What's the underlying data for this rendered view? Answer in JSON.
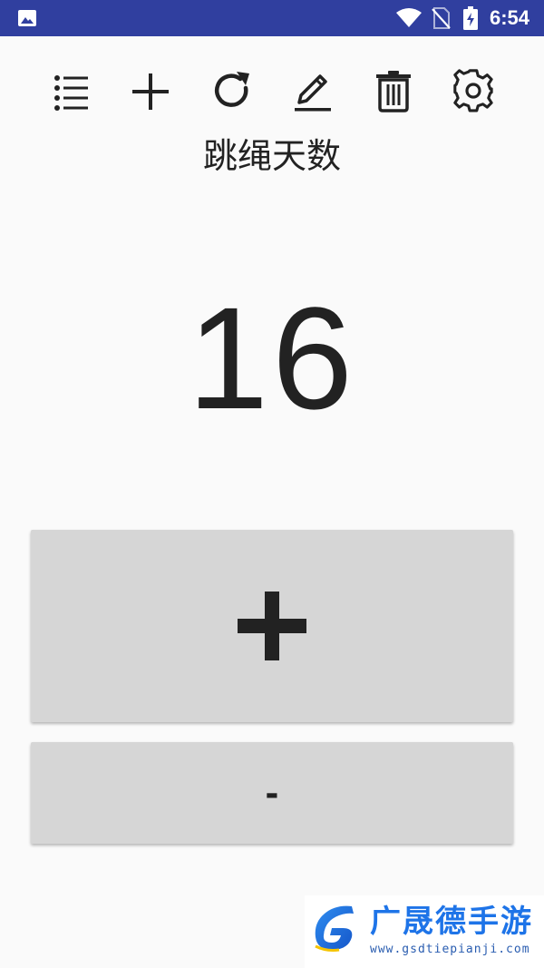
{
  "status_bar": {
    "time": "6:54",
    "icons": [
      "gallery-icon",
      "wifi-icon",
      "no-sim-icon",
      "battery-charging-icon"
    ],
    "background": "#303f9f"
  },
  "toolbar": {
    "items": [
      {
        "name": "list-icon"
      },
      {
        "name": "add-icon"
      },
      {
        "name": "refresh-icon"
      },
      {
        "name": "edit-icon"
      },
      {
        "name": "delete-icon"
      },
      {
        "name": "settings-icon"
      }
    ]
  },
  "main": {
    "title": "跳绳天数",
    "count": "16"
  },
  "buttons": {
    "increment_label": "+",
    "decrement_label": "-",
    "background": "#d6d6d6"
  },
  "watermark": {
    "text": "广晟德手游",
    "url": "www.gsdtiepianji.com"
  }
}
